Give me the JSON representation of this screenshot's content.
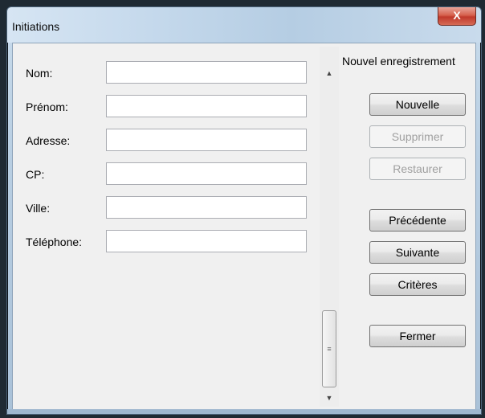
{
  "window": {
    "title": "Initiations",
    "close_label": "X"
  },
  "fields": [
    {
      "label": "Nom:",
      "value": ""
    },
    {
      "label": "Prénom:",
      "value": ""
    },
    {
      "label": "Adresse:",
      "value": ""
    },
    {
      "label": "CP:",
      "value": ""
    },
    {
      "label": "Ville:",
      "value": ""
    },
    {
      "label": "Téléphone:",
      "value": ""
    }
  ],
  "scrollbar": {
    "up_arrow": "▲",
    "down_arrow": "▼",
    "thumb_grip": "≡"
  },
  "panel": {
    "caption": "Nouvel enregistrement",
    "buttons": {
      "nouvelle": "Nouvelle",
      "supprimer": "Supprimer",
      "restaurer": "Restaurer",
      "precedente": "Précédente",
      "suivante": "Suivante",
      "criteres": "Critères",
      "fermer": "Fermer"
    }
  }
}
